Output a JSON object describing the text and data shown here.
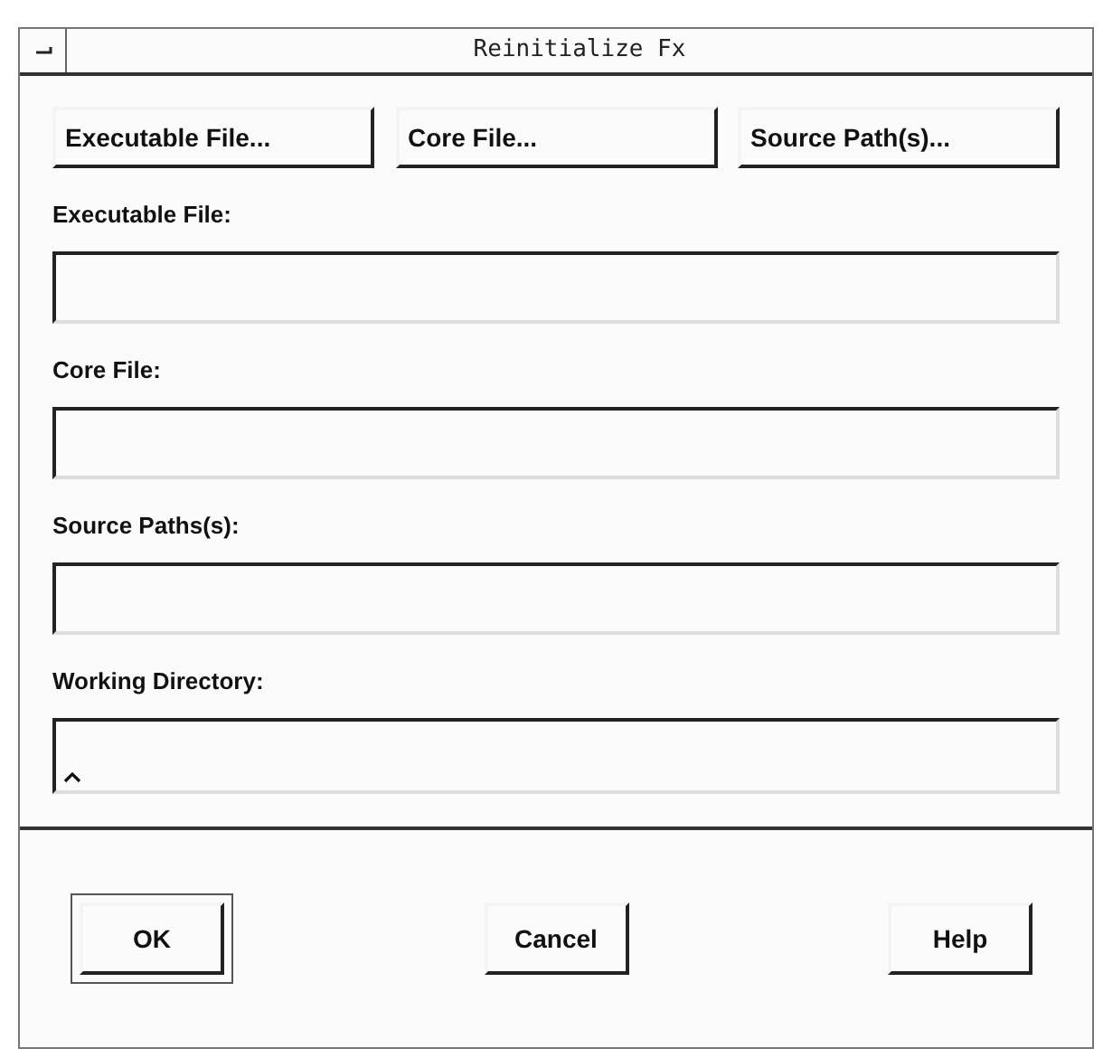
{
  "window": {
    "title": "Reinitialize Fx"
  },
  "top_buttons": [
    "Executable File...",
    "Core File...",
    "Source Path(s)..."
  ],
  "fields": [
    {
      "label": "Executable File:",
      "focused": false
    },
    {
      "label": "Core File:",
      "focused": false
    },
    {
      "label": "Source Paths(s):",
      "focused": false
    },
    {
      "label": "Working Directory:",
      "focused": true
    }
  ],
  "bottom_buttons": [
    {
      "label": "OK",
      "default": true
    },
    {
      "label": "Cancel",
      "default": false
    },
    {
      "label": "Help",
      "default": false
    }
  ]
}
